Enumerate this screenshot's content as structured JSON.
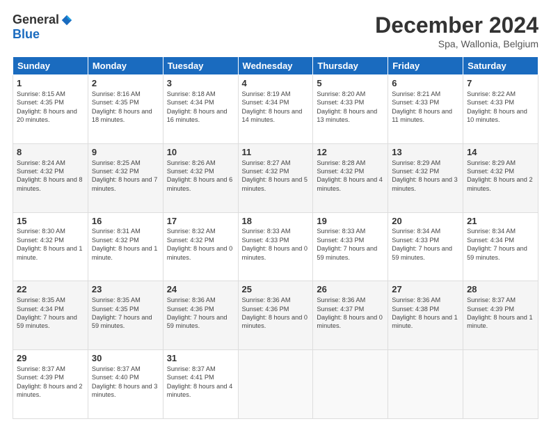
{
  "logo": {
    "general": "General",
    "blue": "Blue"
  },
  "header": {
    "month": "December 2024",
    "location": "Spa, Wallonia, Belgium"
  },
  "days_of_week": [
    "Sunday",
    "Monday",
    "Tuesday",
    "Wednesday",
    "Thursday",
    "Friday",
    "Saturday"
  ],
  "weeks": [
    [
      {
        "day": "1",
        "sunrise": "8:15 AM",
        "sunset": "4:35 PM",
        "daylight": "8 hours and 20 minutes."
      },
      {
        "day": "2",
        "sunrise": "8:16 AM",
        "sunset": "4:35 PM",
        "daylight": "8 hours and 18 minutes."
      },
      {
        "day": "3",
        "sunrise": "8:18 AM",
        "sunset": "4:34 PM",
        "daylight": "8 hours and 16 minutes."
      },
      {
        "day": "4",
        "sunrise": "8:19 AM",
        "sunset": "4:34 PM",
        "daylight": "8 hours and 14 minutes."
      },
      {
        "day": "5",
        "sunrise": "8:20 AM",
        "sunset": "4:33 PM",
        "daylight": "8 hours and 13 minutes."
      },
      {
        "day": "6",
        "sunrise": "8:21 AM",
        "sunset": "4:33 PM",
        "daylight": "8 hours and 11 minutes."
      },
      {
        "day": "7",
        "sunrise": "8:22 AM",
        "sunset": "4:33 PM",
        "daylight": "8 hours and 10 minutes."
      }
    ],
    [
      {
        "day": "8",
        "sunrise": "8:24 AM",
        "sunset": "4:32 PM",
        "daylight": "8 hours and 8 minutes."
      },
      {
        "day": "9",
        "sunrise": "8:25 AM",
        "sunset": "4:32 PM",
        "daylight": "8 hours and 7 minutes."
      },
      {
        "day": "10",
        "sunrise": "8:26 AM",
        "sunset": "4:32 PM",
        "daylight": "8 hours and 6 minutes."
      },
      {
        "day": "11",
        "sunrise": "8:27 AM",
        "sunset": "4:32 PM",
        "daylight": "8 hours and 5 minutes."
      },
      {
        "day": "12",
        "sunrise": "8:28 AM",
        "sunset": "4:32 PM",
        "daylight": "8 hours and 4 minutes."
      },
      {
        "day": "13",
        "sunrise": "8:29 AM",
        "sunset": "4:32 PM",
        "daylight": "8 hours and 3 minutes."
      },
      {
        "day": "14",
        "sunrise": "8:29 AM",
        "sunset": "4:32 PM",
        "daylight": "8 hours and 2 minutes."
      }
    ],
    [
      {
        "day": "15",
        "sunrise": "8:30 AM",
        "sunset": "4:32 PM",
        "daylight": "8 hours and 1 minute."
      },
      {
        "day": "16",
        "sunrise": "8:31 AM",
        "sunset": "4:32 PM",
        "daylight": "8 hours and 1 minute."
      },
      {
        "day": "17",
        "sunrise": "8:32 AM",
        "sunset": "4:32 PM",
        "daylight": "8 hours and 0 minutes."
      },
      {
        "day": "18",
        "sunrise": "8:33 AM",
        "sunset": "4:33 PM",
        "daylight": "8 hours and 0 minutes."
      },
      {
        "day": "19",
        "sunrise": "8:33 AM",
        "sunset": "4:33 PM",
        "daylight": "7 hours and 59 minutes."
      },
      {
        "day": "20",
        "sunrise": "8:34 AM",
        "sunset": "4:33 PM",
        "daylight": "7 hours and 59 minutes."
      },
      {
        "day": "21",
        "sunrise": "8:34 AM",
        "sunset": "4:34 PM",
        "daylight": "7 hours and 59 minutes."
      }
    ],
    [
      {
        "day": "22",
        "sunrise": "8:35 AM",
        "sunset": "4:34 PM",
        "daylight": "7 hours and 59 minutes."
      },
      {
        "day": "23",
        "sunrise": "8:35 AM",
        "sunset": "4:35 PM",
        "daylight": "7 hours and 59 minutes."
      },
      {
        "day": "24",
        "sunrise": "8:36 AM",
        "sunset": "4:36 PM",
        "daylight": "7 hours and 59 minutes."
      },
      {
        "day": "25",
        "sunrise": "8:36 AM",
        "sunset": "4:36 PM",
        "daylight": "8 hours and 0 minutes."
      },
      {
        "day": "26",
        "sunrise": "8:36 AM",
        "sunset": "4:37 PM",
        "daylight": "8 hours and 0 minutes."
      },
      {
        "day": "27",
        "sunrise": "8:36 AM",
        "sunset": "4:38 PM",
        "daylight": "8 hours and 1 minute."
      },
      {
        "day": "28",
        "sunrise": "8:37 AM",
        "sunset": "4:39 PM",
        "daylight": "8 hours and 1 minute."
      }
    ],
    [
      {
        "day": "29",
        "sunrise": "8:37 AM",
        "sunset": "4:39 PM",
        "daylight": "8 hours and 2 minutes."
      },
      {
        "day": "30",
        "sunrise": "8:37 AM",
        "sunset": "4:40 PM",
        "daylight": "8 hours and 3 minutes."
      },
      {
        "day": "31",
        "sunrise": "8:37 AM",
        "sunset": "4:41 PM",
        "daylight": "8 hours and 4 minutes."
      },
      null,
      null,
      null,
      null
    ]
  ],
  "labels": {
    "sunrise": "Sunrise:",
    "sunset": "Sunset:",
    "daylight": "Daylight:"
  }
}
